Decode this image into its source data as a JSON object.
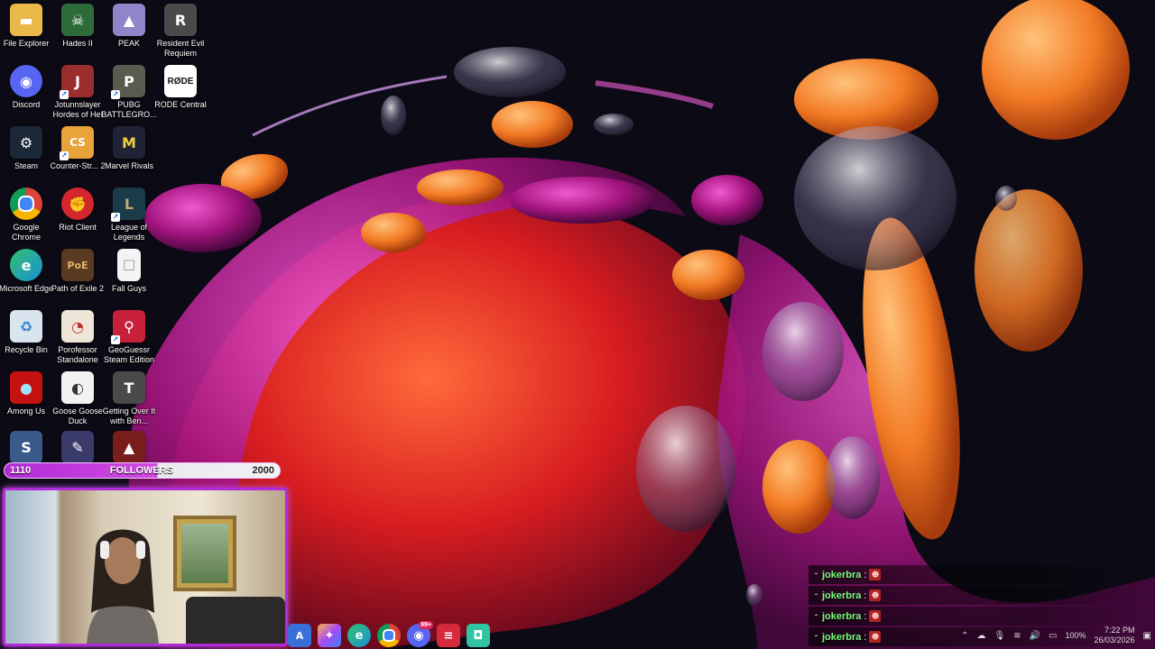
{
  "desktop": {
    "icons": [
      {
        "label": "File Explorer",
        "icon": "folder-icon",
        "color": "#e9b949",
        "glyph": "▬"
      },
      {
        "label": "Hades II",
        "icon": "hades-icon",
        "color": "#2e6b3a",
        "glyph": "☠"
      },
      {
        "label": "PEAK",
        "icon": "peak-icon",
        "color": "#8f86c9",
        "glyph": "▲"
      },
      {
        "label": "Resident Evil Requiem",
        "icon": "resident-evil-icon",
        "color": "#4a4a4a",
        "glyph": "R"
      },
      {
        "label": "Discord",
        "icon": "discord-icon",
        "color": "#5865f2",
        "glyph": "◉"
      },
      {
        "label": "Jotunnslayer Hordes of Hel",
        "icon": "jotunnslayer-icon",
        "color": "#9b2d2d",
        "glyph": "J"
      },
      {
        "label": "PUBG BATTLEGRO...",
        "icon": "pubg-icon",
        "color": "#5a5a4e",
        "glyph": "P"
      },
      {
        "label": "RODE Central",
        "icon": "rode-icon",
        "color": "#ffffff",
        "glyph": "RØDE"
      },
      {
        "label": "Steam",
        "icon": "steam-icon",
        "color": "#1b2838",
        "glyph": "⚙"
      },
      {
        "label": "Counter-Str... 2",
        "icon": "counter-strike-icon",
        "color": "#e8a33a",
        "glyph": "CS"
      },
      {
        "label": "Marvel Rivals",
        "icon": "marvel-rivals-icon",
        "color": "#1f2335",
        "glyph": "M"
      },
      {
        "label": "Google Chrome",
        "icon": "chrome-icon",
        "color": "#2c9c4b",
        "glyph": "◎"
      },
      {
        "label": "Riot Client",
        "icon": "riot-client-icon",
        "color": "#d3262d",
        "glyph": "✊"
      },
      {
        "label": "League of Legends",
        "icon": "league-of-legends-icon",
        "color": "#1a3b4a",
        "glyph": "L"
      },
      {
        "label": "Microsoft Edge",
        "icon": "edge-icon",
        "color": "#1d8fd6",
        "glyph": "e"
      },
      {
        "label": "Path of Exile 2",
        "icon": "path-of-exile-icon",
        "color": "#5a3a20",
        "glyph": "PoE"
      },
      {
        "label": "Fall Guys",
        "icon": "fall-guys-icon",
        "color": "#f4f4f4",
        "glyph": "☐"
      },
      {
        "label": "Recycle Bin",
        "icon": "recycle-bin-icon",
        "color": "#d9e4ef",
        "glyph": "♻"
      },
      {
        "label": "Porofessor Standalone",
        "icon": "porofessor-icon",
        "color": "#efe6da",
        "glyph": "◔"
      },
      {
        "label": "GeoGuessr Steam Edition",
        "icon": "geoguessr-icon",
        "color": "#c8203a",
        "glyph": "⚲"
      },
      {
        "label": "Among Us",
        "icon": "among-us-icon",
        "color": "#c51111",
        "glyph": "●"
      },
      {
        "label": "Goose Goose Duck",
        "icon": "goose-goose-duck-icon",
        "color": "#f2f2f2",
        "glyph": "◐"
      },
      {
        "label": "Getting Over It with Ben...",
        "icon": "getting-over-it-icon",
        "color": "#4a4a4a",
        "glyph": "T"
      },
      {
        "label": "",
        "icon": "survivor-game-icon",
        "color": "#3a5a8a",
        "glyph": "S"
      },
      {
        "label": "",
        "icon": "feather-app-icon",
        "color": "#3b3b6b",
        "glyph": "✎"
      },
      {
        "label": "",
        "icon": "hooded-game-icon",
        "color": "#7a1d1d",
        "glyph": "▲"
      }
    ]
  },
  "overlay": {
    "followers_current": "1110",
    "followers_label": "FOLLOWERS",
    "followers_goal": "2000",
    "progress_fraction": 0.555
  },
  "chat": {
    "messages": [
      {
        "user": "jokerbra"
      },
      {
        "user": "jokerbra"
      },
      {
        "user": "jokerbra"
      },
      {
        "user": "jokerbra"
      }
    ]
  },
  "taskbar": {
    "apps": [
      {
        "icon": "app-launcher-icon",
        "color": "#3a6fd8",
        "glyph": "A",
        "badge": ""
      },
      {
        "icon": "copilot-icon",
        "color": "#5a3bd8",
        "glyph": "✦",
        "badge": ""
      },
      {
        "icon": "edge-icon",
        "color": "#1d8fd6",
        "glyph": "e",
        "badge": ""
      },
      {
        "icon": "chrome-icon",
        "color": "#2c9c4b",
        "glyph": "◎",
        "badge": ""
      },
      {
        "icon": "discord-icon",
        "color": "#5865f2",
        "glyph": "◉",
        "badge": "99+"
      },
      {
        "icon": "elgato-icon",
        "color": "#d42a3c",
        "glyph": "≡",
        "badge": ""
      },
      {
        "icon": "streamlabs-icon",
        "color": "#31c3a2",
        "glyph": "◘",
        "badge": ""
      }
    ],
    "battery": "100%",
    "time": "7:22 PM",
    "date": "26/03/2026"
  }
}
